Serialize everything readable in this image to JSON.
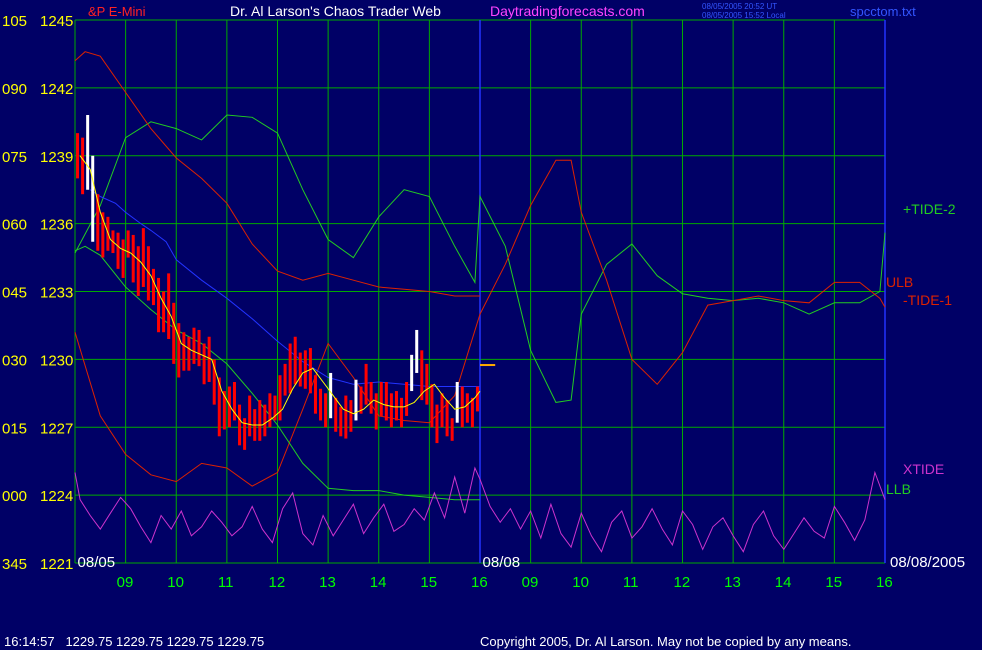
{
  "header": {
    "symbol": "&P E-Mini",
    "title": "Dr. Al Larson's Chaos Trader Web",
    "site": "Daytradingforecasts.com",
    "timestamp_ut": "08/05/2005 20:52 UT",
    "timestamp_local": "08/05/2005 15:52 Local",
    "filename": "spcctom.txt"
  },
  "footer": {
    "quote": "16:14:57   1229.75 1229.75 1229.75 1229.75",
    "copyright": "Copyright 2005, Dr. Al Larson. May not be copied by any means."
  },
  "colors": {
    "background": "#000066",
    "grid": "#00aa00",
    "tide_plus": "#22cc22",
    "tide_minus": "#dd2200",
    "xtide": "#cc33cc",
    "bars": "#ff0000",
    "bars_up": "#ffffff",
    "average": "#ffff00",
    "blue_line": "#2233ff",
    "y_labels": "#ffff00",
    "x_labels": "#00ff00"
  },
  "chart_data": {
    "type": "line",
    "y_axis": {
      "min": 1221,
      "max": 1245,
      "step": 3,
      "left_labels": [
        "345",
        "000",
        "015",
        "030",
        "045",
        "060",
        "075",
        "090",
        "105"
      ],
      "price_labels": [
        "1221",
        "1224",
        "1227",
        "1230",
        "1233",
        "1236",
        "1239",
        "1242",
        "1245"
      ]
    },
    "x_axis": {
      "min": 8.0,
      "max": 24.0,
      "hour_ticks": [
        9,
        10,
        11,
        12,
        13,
        14,
        15,
        16,
        17,
        18,
        19,
        20,
        21,
        22,
        23,
        24
      ],
      "hour_labels": [
        "09",
        "10",
        "11",
        "12",
        "13",
        "14",
        "15",
        "16",
        "09",
        "10",
        "11",
        "12",
        "13",
        "14",
        "15",
        "16"
      ],
      "date_labels": [
        {
          "x": 8.05,
          "text": "08/05"
        },
        {
          "x": 16.05,
          "text": "08/08"
        }
      ],
      "date_right": "08/08/2005",
      "separator_x": 16.0
    },
    "series": [
      {
        "name": "+TIDE-2",
        "x": [
          8.0,
          8.5,
          9.0,
          9.5,
          10.0,
          10.5,
          11.0,
          11.5,
          12.0,
          12.5,
          13.0,
          13.5,
          14.0,
          14.5,
          15.0,
          15.5,
          15.9,
          16.0,
          16.5,
          17.0,
          17.5,
          17.8,
          18.0,
          18.5,
          19.0,
          19.5,
          20.0,
          20.5,
          21.0,
          21.5,
          22.0,
          22.5,
          23.0,
          23.5,
          23.9,
          24.0
        ],
        "y": [
          1234.7,
          1236.8,
          1239.8,
          1240.5,
          1240.2,
          1239.7,
          1240.8,
          1240.7,
          1240.0,
          1237.5,
          1235.3,
          1234.5,
          1236.3,
          1237.5,
          1237.2,
          1235.0,
          1233.4,
          1237.2,
          1235.0,
          1230.4,
          1228.1,
          1228.2,
          1232.0,
          1234.2,
          1235.1,
          1233.7,
          1232.9,
          1232.7,
          1232.6,
          1232.7,
          1232.5,
          1232.0,
          1232.5,
          1232.5,
          1233.0,
          1235.6
        ]
      },
      {
        "name": "ULB",
        "x": [
          8.0,
          8.2,
          8.5,
          9.0,
          9.5,
          10.0,
          10.5,
          11.0,
          11.5,
          12.0,
          12.5,
          13.0,
          13.5,
          14.0,
          14.5,
          15.0,
          15.5,
          16.0
        ],
        "y": [
          1243.2,
          1243.6,
          1243.4,
          1241.8,
          1240.2,
          1238.9,
          1238.0,
          1236.9,
          1235.1,
          1233.9,
          1233.5,
          1233.8,
          1233.5,
          1233.2,
          1233.1,
          1233.0,
          1232.8,
          1232.8
        ]
      },
      {
        "name": "-TIDE-1",
        "x": [
          8.0,
          8.5,
          9.0,
          9.5,
          10.0,
          10.5,
          11.0,
          11.5,
          12.0,
          12.5,
          13.0,
          13.5,
          14.0,
          14.5,
          15.0,
          15.5,
          16.0,
          16.5,
          17.0,
          17.5,
          17.8,
          18.0,
          18.5,
          19.0,
          19.5,
          20.0,
          20.5,
          21.0,
          21.5,
          22.0,
          22.5,
          23.0,
          23.5,
          23.9,
          24.0
        ],
        "y": [
          1231.2,
          1227.5,
          1225.8,
          1224.9,
          1224.6,
          1225.4,
          1225.2,
          1224.4,
          1225.0,
          1227.8,
          1230.7,
          1229.2,
          1227.5,
          1227.3,
          1227.2,
          1228.4,
          1232.0,
          1234.2,
          1236.8,
          1238.8,
          1238.8,
          1236.5,
          1233.5,
          1230.0,
          1228.9,
          1230.3,
          1232.4,
          1232.6,
          1232.8,
          1232.6,
          1232.5,
          1233.4,
          1233.4,
          1232.7,
          1232.3
        ]
      },
      {
        "name": "LLB",
        "x": [
          8.0,
          8.2,
          8.5,
          9.0,
          9.5,
          10.0,
          10.5,
          11.0,
          11.5,
          12.0,
          12.5,
          13.0,
          13.5,
          14.0,
          14.5,
          15.0,
          15.5,
          16.0
        ],
        "y": [
          1234.8,
          1235.0,
          1234.6,
          1233.2,
          1232.2,
          1231.3,
          1230.7,
          1229.8,
          1228.5,
          1227.1,
          1225.4,
          1224.3,
          1224.2,
          1224.2,
          1224.0,
          1223.9,
          1223.8,
          1223.8
        ]
      },
      {
        "name": "XTIDE",
        "x": [
          8.0,
          8.1,
          8.3,
          8.5,
          8.7,
          8.9,
          9.1,
          9.3,
          9.5,
          9.7,
          9.9,
          10.1,
          10.3,
          10.5,
          10.7,
          10.9,
          11.1,
          11.3,
          11.5,
          11.7,
          11.9,
          12.1,
          12.3,
          12.5,
          12.7,
          12.9,
          13.1,
          13.3,
          13.5,
          13.7,
          13.9,
          14.1,
          14.3,
          14.5,
          14.7,
          14.9,
          15.1,
          15.3,
          15.5,
          15.7,
          15.9,
          16.0,
          16.2,
          16.4,
          16.6,
          16.8,
          17.0,
          17.2,
          17.4,
          17.6,
          17.8,
          18.0,
          18.2,
          18.4,
          18.6,
          18.8,
          19.0,
          19.2,
          19.4,
          19.6,
          19.8,
          20.0,
          20.2,
          20.4,
          20.6,
          20.8,
          21.0,
          21.2,
          21.4,
          21.6,
          21.8,
          22.0,
          22.2,
          22.4,
          22.6,
          22.8,
          23.0,
          23.2,
          23.4,
          23.6,
          23.8,
          24.0
        ],
        "y": [
          1225.0,
          1223.8,
          1223.1,
          1222.5,
          1223.2,
          1223.9,
          1223.4,
          1222.6,
          1221.9,
          1223.1,
          1222.5,
          1223.3,
          1222.2,
          1222.6,
          1223.3,
          1222.8,
          1222.2,
          1222.6,
          1223.5,
          1222.5,
          1221.9,
          1223.4,
          1224.1,
          1222.3,
          1221.8,
          1223.1,
          1222.2,
          1222.9,
          1223.6,
          1222.3,
          1223.0,
          1223.6,
          1222.4,
          1222.7,
          1223.4,
          1222.9,
          1224.1,
          1223.0,
          1224.8,
          1223.2,
          1225.2,
          1224.7,
          1223.5,
          1222.8,
          1223.4,
          1222.5,
          1223.3,
          1222.1,
          1223.6,
          1222.3,
          1221.7,
          1223.2,
          1222.2,
          1221.5,
          1222.8,
          1223.3,
          1222.1,
          1222.6,
          1223.4,
          1222.5,
          1221.8,
          1223.3,
          1222.7,
          1221.6,
          1222.6,
          1223.0,
          1222.2,
          1221.5,
          1222.7,
          1223.3,
          1222.2,
          1221.6,
          1222.3,
          1223.0,
          1222.4,
          1222.1,
          1223.5,
          1222.8,
          1222.0,
          1222.9,
          1225.0,
          1223.8
        ]
      },
      {
        "name": "",
        "x": [
          8.3,
          8.5,
          8.8,
          9.0,
          9.3,
          9.5,
          9.8,
          10.0,
          10.5,
          11.0,
          11.5,
          12.0,
          12.5,
          13.0,
          13.5,
          14.0,
          14.5,
          15.0,
          15.5,
          16.0
        ],
        "y": [
          1237.5,
          1237.2,
          1236.9,
          1236.5,
          1236.0,
          1235.7,
          1235.2,
          1234.4,
          1233.5,
          1232.7,
          1231.8,
          1230.8,
          1229.9,
          1229.2,
          1228.9,
          1229.0,
          1228.9,
          1228.8,
          1228.8,
          1228.8
        ]
      }
    ],
    "price_bars": {
      "x": [
        8.05,
        8.15,
        8.25,
        8.35,
        8.45,
        8.55,
        8.65,
        8.75,
        8.85,
        8.95,
        9.05,
        9.15,
        9.25,
        9.35,
        9.45,
        9.55,
        9.65,
        9.75,
        9.85,
        9.95,
        10.05,
        10.15,
        10.25,
        10.35,
        10.45,
        10.55,
        10.65,
        10.75,
        10.85,
        10.95,
        11.05,
        11.15,
        11.25,
        11.35,
        11.45,
        11.55,
        11.65,
        11.75,
        11.85,
        11.95,
        12.05,
        12.15,
        12.25,
        12.35,
        12.45,
        12.55,
        12.65,
        12.75,
        12.85,
        12.95,
        13.05,
        13.15,
        13.25,
        13.35,
        13.45,
        13.55,
        13.65,
        13.75,
        13.85,
        13.95,
        14.05,
        14.15,
        14.25,
        14.35,
        14.45,
        14.55,
        14.65,
        14.75,
        14.85,
        14.95,
        15.05,
        15.15,
        15.25,
        15.35,
        15.45,
        15.55,
        15.65,
        15.75,
        15.85,
        15.95
      ],
      "high": [
        1240.0,
        1239.8,
        1240.8,
        1239.0,
        1237.3,
        1236.5,
        1236.3,
        1235.7,
        1235.6,
        1235.3,
        1235.7,
        1235.5,
        1235.0,
        1235.8,
        1235.0,
        1234.0,
        1233.6,
        1233.0,
        1233.8,
        1232.5,
        1231.6,
        1231.2,
        1231.0,
        1231.4,
        1231.3,
        1230.7,
        1231.0,
        1230.0,
        1229.2,
        1228.6,
        1228.8,
        1229.0,
        1228.0,
        1227.4,
        1228.4,
        1227.8,
        1228.2,
        1228.0,
        1228.5,
        1228.4,
        1229.3,
        1229.8,
        1230.7,
        1231.0,
        1230.3,
        1230.4,
        1230.5,
        1229.3,
        1228.7,
        1228.5,
        1229.4,
        1228.3,
        1227.9,
        1228.4,
        1228.2,
        1229.1,
        1228.8,
        1229.8,
        1229.0,
        1228.5,
        1229.0,
        1229.0,
        1228.5,
        1228.6,
        1228.3,
        1229.0,
        1230.2,
        1231.3,
        1230.4,
        1229.8,
        1228.9,
        1228.0,
        1228.5,
        1228.2,
        1227.4,
        1229.0,
        1228.8,
        1228.5,
        1228.3,
        1228.8
      ],
      "low": [
        1238.0,
        1237.3,
        1237.5,
        1235.2,
        1234.8,
        1234.5,
        1234.8,
        1234.7,
        1234.0,
        1233.6,
        1234.5,
        1233.4,
        1232.8,
        1233.2,
        1232.6,
        1232.4,
        1231.2,
        1231.2,
        1230.9,
        1229.8,
        1229.2,
        1229.5,
        1229.5,
        1229.8,
        1229.7,
        1228.9,
        1229.0,
        1228.0,
        1226.6,
        1226.9,
        1227.0,
        1227.3,
        1226.2,
        1226.0,
        1226.6,
        1226.4,
        1226.4,
        1226.6,
        1227.0,
        1227.3,
        1227.3,
        1228.4,
        1228.5,
        1228.9,
        1228.8,
        1228.7,
        1228.5,
        1227.6,
        1227.3,
        1227.0,
        1227.4,
        1226.8,
        1226.6,
        1226.5,
        1226.8,
        1227.3,
        1227.6,
        1228.0,
        1227.6,
        1226.9,
        1227.5,
        1227.3,
        1227.0,
        1227.3,
        1227.0,
        1227.5,
        1228.6,
        1229.4,
        1228.2,
        1228.0,
        1227.0,
        1226.3,
        1227.0,
        1226.6,
        1226.4,
        1227.2,
        1227.0,
        1227.2,
        1227.0,
        1227.7
      ],
      "close": [
        1239.2,
        1238.8,
        1238.0,
        1236.5,
        1235.6,
        1235.5,
        1235.6,
        1235.0,
        1234.9,
        1234.2,
        1235.2,
        1234.7,
        1233.7,
        1234.1,
        1233.1,
        1233.5,
        1232.0,
        1232.3,
        1231.5,
        1231.2,
        1230.0,
        1230.6,
        1230.6,
        1230.0,
        1230.5,
        1229.7,
        1229.6,
        1228.5,
        1227.4,
        1227.5,
        1228.3,
        1227.8,
        1226.8,
        1227.0,
        1227.1,
        1227.4,
        1227.0,
        1227.4,
        1228.0,
        1227.6,
        1228.2,
        1229.6,
        1229.8,
        1230.0,
        1229.4,
        1229.9,
        1229.5,
        1228.3,
        1228.0,
        1227.6,
        1228.0,
        1227.2,
        1227.2,
        1227.6,
        1227.6,
        1228.4,
        1228.3,
        1228.6,
        1228.5,
        1227.8,
        1228.1,
        1227.8,
        1227.8,
        1228.0,
        1227.7,
        1228.1,
        1229.0,
        1230.0,
        1229.3,
        1229.0,
        1228.2,
        1227.2,
        1227.8,
        1227.3,
        1227.0,
        1228.4,
        1228.3,
        1227.8,
        1227.6,
        1228.4
      ]
    },
    "average": {
      "x": [
        8.1,
        8.3,
        8.5,
        8.7,
        8.9,
        9.1,
        9.3,
        9.5,
        9.7,
        9.9,
        10.1,
        10.3,
        10.5,
        10.7,
        10.9,
        11.1,
        11.3,
        11.5,
        11.7,
        11.9,
        12.1,
        12.3,
        12.5,
        12.7,
        12.9,
        13.1,
        13.3,
        13.5,
        13.7,
        13.9,
        14.1,
        14.3,
        14.5,
        14.7,
        14.9,
        15.1,
        15.3,
        15.5,
        15.7,
        15.9,
        16.0
      ],
      "y": [
        1239.0,
        1238.4,
        1236.5,
        1235.3,
        1234.9,
        1234.7,
        1234.3,
        1233.7,
        1232.7,
        1231.9,
        1230.7,
        1230.4,
        1230.2,
        1230.0,
        1228.6,
        1227.8,
        1227.2,
        1227.1,
        1227.1,
        1227.4,
        1227.8,
        1228.7,
        1229.4,
        1229.6,
        1229.0,
        1228.4,
        1227.8,
        1227.6,
        1227.8,
        1228.2,
        1228.0,
        1227.9,
        1227.9,
        1228.1,
        1228.6,
        1228.9,
        1228.3,
        1227.8,
        1227.9,
        1228.3,
        1228.6
      ]
    },
    "last_price": {
      "x_start": 16.0,
      "x_end": 16.3,
      "y": 1229.75
    },
    "series_labels": [
      {
        "name": "+TIDE-2",
        "color": "#22cc22"
      },
      {
        "name": "ULB",
        "color": "#dd2200"
      },
      {
        "name": "-TIDE-1",
        "color": "#dd2200"
      },
      {
        "name": "XTIDE",
        "color": "#cc33cc"
      },
      {
        "name": "LLB",
        "color": "#22cc22"
      }
    ]
  }
}
